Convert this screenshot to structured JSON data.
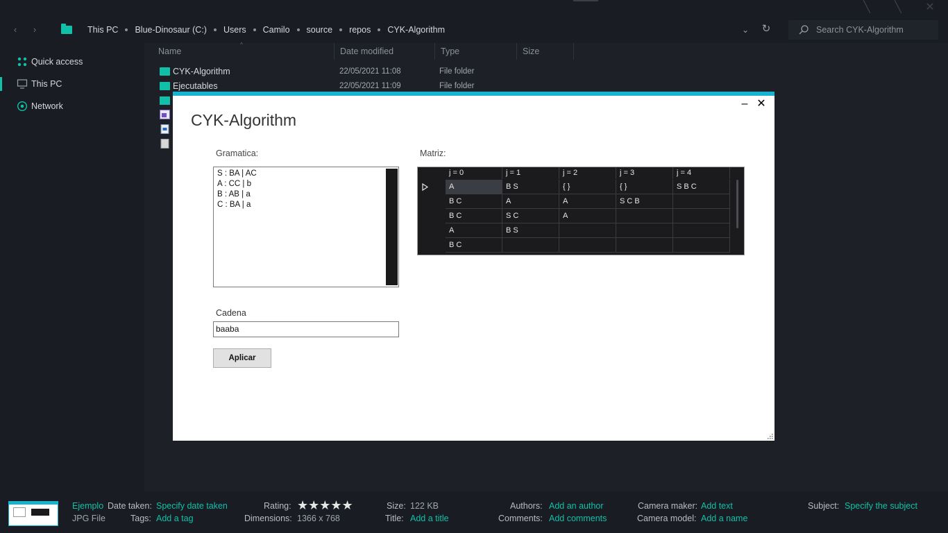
{
  "explorer": {
    "breadcrumb": [
      "This PC",
      "Blue-Dinosaur (C:)",
      "Users",
      "Camilo",
      "source",
      "repos",
      "CYK-Algorithm"
    ],
    "search_placeholder": "Search CYK-Algorithm",
    "sidebar": [
      {
        "label": "Quick access",
        "icon": "quick-access-icon"
      },
      {
        "label": "This PC",
        "icon": "monitor-icon"
      },
      {
        "label": "Network",
        "icon": "network-icon"
      }
    ],
    "columns": [
      "Name",
      "Date modified",
      "Type",
      "Size"
    ],
    "files": [
      {
        "name": "CYK-Algorithm",
        "date": "22/05/2021 11:08",
        "type": "File folder"
      },
      {
        "name": "Ejecutables",
        "date": "22/05/2021 11:09",
        "type": "File folder"
      }
    ]
  },
  "app": {
    "title": "CYK-Algorithm",
    "minimize": "–",
    "close": "✕",
    "gramatica_label": "Gramatica:",
    "grammar_lines": [
      "S : BA | AC",
      "A : CC | b",
      "B : AB | a",
      "C : BA | a"
    ],
    "cadena_label": "Cadena",
    "cadena_value": "baaba",
    "aplicar_label": "Aplicar",
    "matriz_label": "Matriz:",
    "matrix": {
      "headers": [
        "j = 0",
        "j = 1",
        "j = 2",
        "j = 3",
        "j = 4"
      ],
      "rows": [
        [
          "A",
          "B S",
          "{ }",
          "{ }",
          "S B C"
        ],
        [
          "B C",
          "A",
          "A",
          "S C B",
          ""
        ],
        [
          "B C",
          "S C",
          "A",
          "",
          ""
        ],
        [
          "A",
          "B S",
          "",
          "",
          ""
        ],
        [
          "B C",
          "",
          "",
          "",
          ""
        ]
      ]
    }
  },
  "details": {
    "file_name": "Ejemplo",
    "file_type": "JPG File",
    "date_taken_label": "Date taken:",
    "date_taken_value": "Specify date taken",
    "tags_label": "Tags:",
    "tags_value": "Add a tag",
    "rating_label": "Rating:",
    "rating_stars": "★★★★★",
    "dimensions_label": "Dimensions:",
    "dimensions_value": "1366 x 768",
    "size_label": "Size:",
    "size_value": "122 KB",
    "title_label": "Title:",
    "title_value": "Add a title",
    "authors_label": "Authors:",
    "authors_value": "Add an author",
    "comments_label": "Comments:",
    "comments_value": "Add comments",
    "camera_maker_label": "Camera maker:",
    "camera_maker_value": "Add text",
    "camera_model_label": "Camera model:",
    "camera_model_value": "Add a name",
    "subject_label": "Subject:",
    "subject_value": "Specify the subject"
  },
  "colors": {
    "accent": "#11c0a8",
    "app_titlebar": "#17b3d1",
    "background": "#191c22",
    "grid_background": "#1b1b1e"
  }
}
